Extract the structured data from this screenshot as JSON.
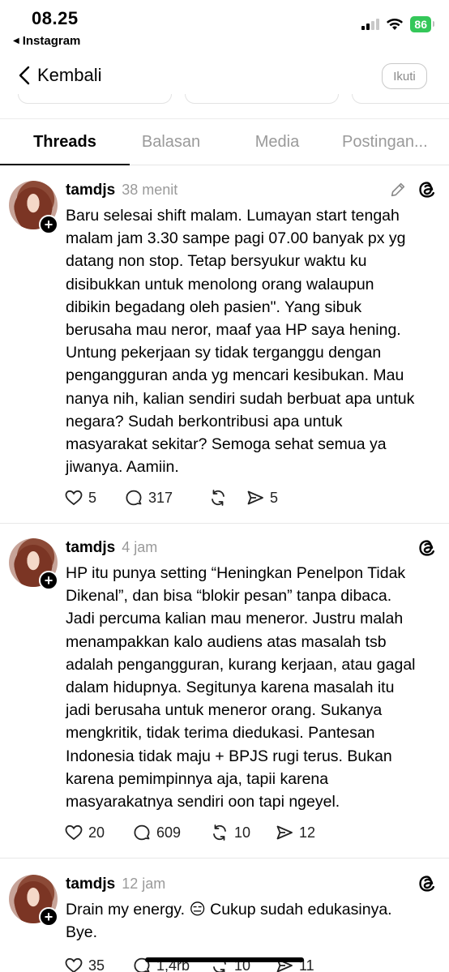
{
  "status_bar": {
    "time": "08.25",
    "back_app": "Instagram",
    "battery": "86"
  },
  "header": {
    "back_label": "Kembali",
    "follow_label": "Ikuti"
  },
  "tabs": [
    {
      "label": "Threads",
      "active": true
    },
    {
      "label": "Balasan",
      "active": false
    },
    {
      "label": "Media",
      "active": false
    },
    {
      "label": "Postingan...",
      "active": false
    }
  ],
  "posts": [
    {
      "username": "tamdjs",
      "age": "38 menit",
      "text": "Baru selesai shift malam. Lumayan start tengah\nmalam jam 3.30 sampe pagi 07.00 banyak px yg\ndatang non stop. Tetap bersyukur waktu ku\ndisibukkan untuk menolong orang walaupun\ndibikin begadang oleh pasien\". Yang sibuk\nberusaha mau neror, maaf yaa HP saya hening.\nUntung pekerjaan sy tidak terganggu dengan\npengangguran anda yg mencari kesibukan. Mau\nnanya nih, kalian sendiri sudah berbuat apa untuk\nnegara? Sudah berkontribusi apa untuk\nmasyarakat sekitar? Semoga sehat semua ya\njiwanya. Aamiin.",
      "likes": "5",
      "replies": "317",
      "reposts": "",
      "shares": "5"
    },
    {
      "username": "tamdjs",
      "age": "4 jam",
      "text": "HP itu punya setting “Heningkan Penelpon Tidak\nDikenal”, dan bisa “blokir pesan” tanpa dibaca.\nJadi percuma kalian mau meneror. Justru malah\nmenampakkan kalo audiens atas masalah tsb\nadalah pengangguran, kurang kerjaan, atau gagal\ndalam hidupnya. Segitunya karena masalah itu\njadi berusaha untuk meneror orang. Sukanya\nmengkritik, tidak terima diedukasi. Pantesan\nIndonesia tidak maju + BPJS rugi terus. Bukan\nkarena pemimpinnya aja, tapii karena\nmasyarakatnya sendiri oon tapi ngeyel.",
      "likes": "20",
      "replies": "609",
      "reposts": "10",
      "shares": "12"
    },
    {
      "username": "tamdjs",
      "age": "12 jam",
      "text": "Drain my energy. 😑 Cukup sudah edukasinya.\nBye.",
      "likes": "35",
      "replies": "1,4rb",
      "reposts": "10",
      "shares": "11"
    }
  ]
}
